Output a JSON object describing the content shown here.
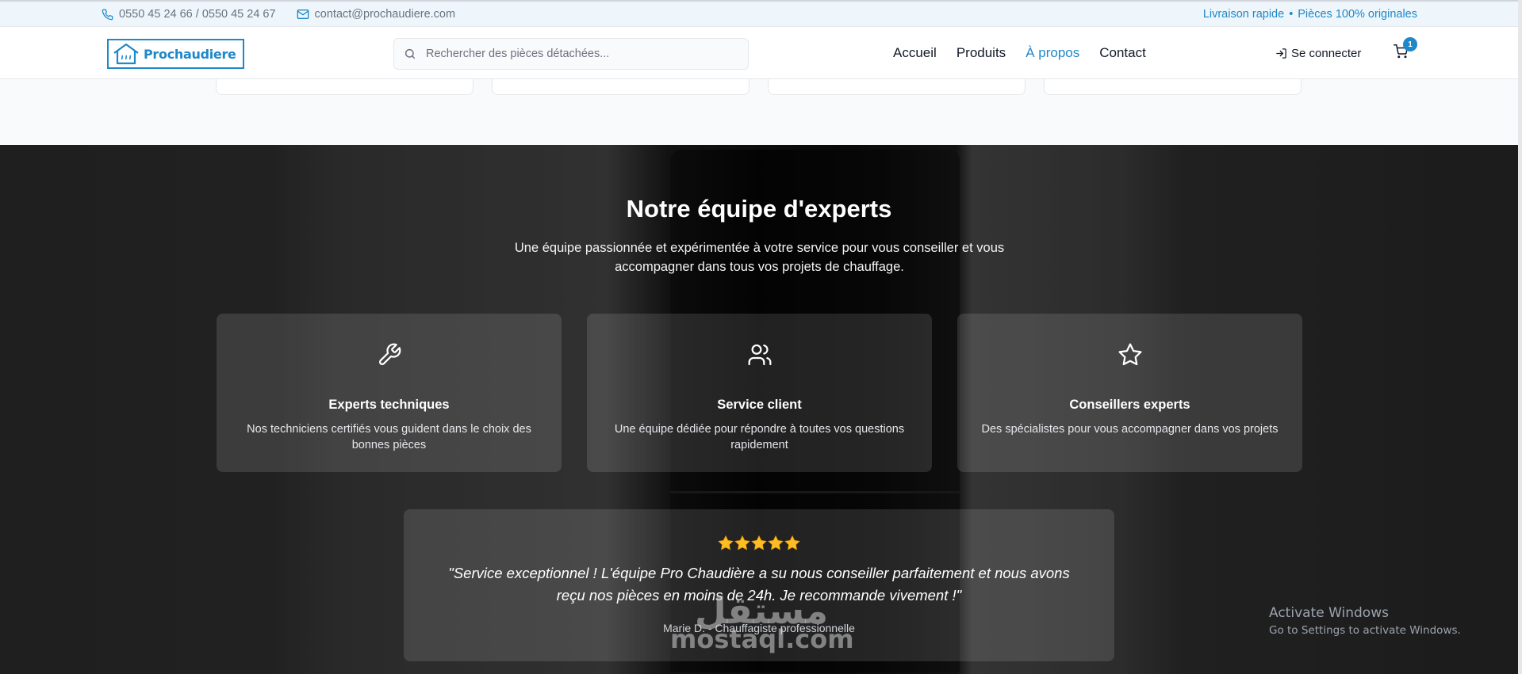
{
  "topbar": {
    "phone": "0550 45 24 66 / 0550 45 24 67",
    "email": "contact@prochaudiere.com",
    "promo_1": "Livraison rapide",
    "separator": "•",
    "promo_2": "Pièces 100% originales",
    "icons": [
      "phone-icon",
      "mail-icon"
    ]
  },
  "header": {
    "logo_text": "Prochaudiere",
    "search_placeholder": "Rechercher des pièces détachées...",
    "nav": [
      "Accueil",
      "Produits",
      "À propos",
      "Contact"
    ],
    "active_nav": "À propos",
    "login_label": "Se connecter",
    "cart_count": "1",
    "accent_color": "#1e88c8"
  },
  "team": {
    "title": "Notre équipe d'experts",
    "subtitle": "Une équipe passionnée et expérimentée à votre service pour vous conseiller et vous accompagner dans tous vos projets de chauffage.",
    "cards": [
      {
        "icon": "wrench-icon",
        "title": "Experts techniques",
        "desc": "Nos techniciens certifiés vous guident dans le choix des bonnes pièces"
      },
      {
        "icon": "users-icon",
        "title": "Service client",
        "desc": "Une équipe dédiée pour répondre à toutes vos questions rapidement"
      },
      {
        "icon": "star-icon",
        "title": "Conseillers experts",
        "desc": "Des spécialistes pour vous accompagner dans vos projets"
      }
    ],
    "testimonial": {
      "rating": 5,
      "star_color": "#fbbf24",
      "quote": "\"Service exceptionnel ! L'équipe Pro Chaudière a su nous conseiller parfaitement et nous avons reçu nos pièces en moins de 24h. Je recommande vivement !\"",
      "author": "Marie D. - Chauffagiste professionnelle"
    }
  },
  "watermark": {
    "arabic": "مستقل",
    "latin": "mostaql.com"
  },
  "windows": {
    "title": "Activate Windows",
    "subtitle": "Go to Settings to activate Windows."
  }
}
